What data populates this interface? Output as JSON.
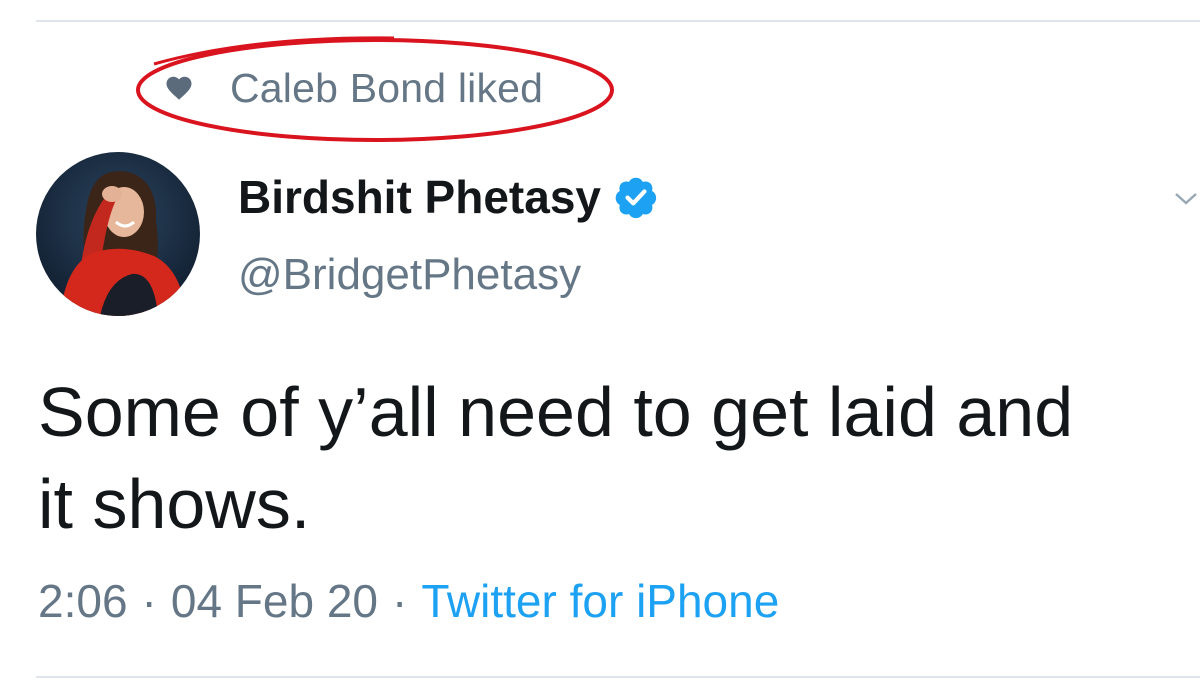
{
  "social_context": {
    "icon": "heart-icon",
    "text": "Caleb Bond liked",
    "highlight_color": "#d9141e"
  },
  "tweet": {
    "author": {
      "display_name": "Birdshit Phetasy",
      "handle": "@BridgetPhetasy",
      "verified": true,
      "verified_color": "#1da1f2"
    },
    "text": "Some of y’all need to get laid and\nit shows.",
    "time": "2:06",
    "date": "04 Feb 20",
    "separator": "·",
    "source": "Twitter for iPhone"
  },
  "colors": {
    "text_primary": "#14171a",
    "text_secondary": "#657786",
    "link": "#1da1f2",
    "divider": "#dfe5ea"
  }
}
